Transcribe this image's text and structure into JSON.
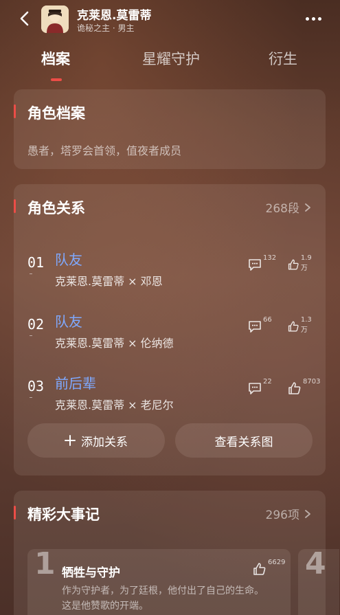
{
  "header": {
    "title": "克莱恩.莫雷蒂",
    "subtitle": "诡秘之主 · 男主",
    "back_icon": "chevron-left-icon",
    "more_icon": "more-dots-icon"
  },
  "tabs": [
    {
      "label": "档案",
      "active": true
    },
    {
      "label": "星耀守护",
      "active": false
    },
    {
      "label": "衍生",
      "active": false
    }
  ],
  "profile": {
    "title": "角色档案",
    "text": "愚者，塔罗会首领，值夜者成员"
  },
  "relations": {
    "title": "角色关系",
    "count": "268段",
    "items": [
      {
        "num": "01",
        "type": "队友",
        "names": "克莱恩.莫雷蒂 × 邓恩",
        "comments": "132",
        "likes": "1.9万"
      },
      {
        "num": "02",
        "type": "队友",
        "names": "克莱恩.莫雷蒂 × 伦纳德",
        "comments": "66",
        "likes": "1.3万"
      },
      {
        "num": "03",
        "type": "前后辈",
        "names": "克莱恩.莫雷蒂 × 老尼尔",
        "comments": "22",
        "likes": "8703"
      }
    ],
    "add_button": "添加关系",
    "view_button": "查看关系图"
  },
  "events": {
    "title": "精彩大事记",
    "count": "296项",
    "items": [
      {
        "num": "1",
        "title": "牺牲与守护",
        "desc": "作为守护者，为了廷根，他付出了自己的生命。这是他赞歌的开端。",
        "likes": "6629"
      },
      {
        "num": "4"
      }
    ]
  },
  "colors": {
    "accent": "#ec4d47",
    "link": "#7fa9ff"
  }
}
